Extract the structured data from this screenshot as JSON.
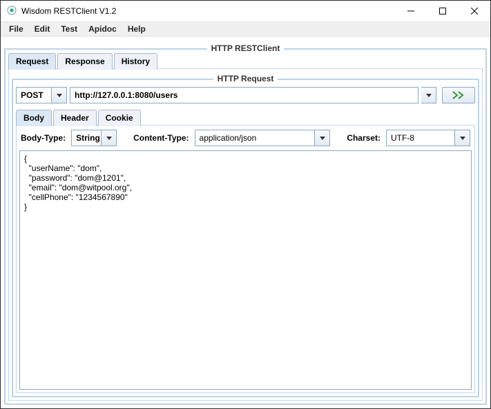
{
  "window": {
    "title": "Wisdom RESTClient V1.2"
  },
  "menu": {
    "items": [
      "File",
      "Edit",
      "Test",
      "Apidoc",
      "Help"
    ]
  },
  "group1": {
    "title": "HTTP RESTClient",
    "tabs": [
      "Request",
      "Response",
      "History"
    ],
    "active": 0
  },
  "group2": {
    "title": "HTTP Request"
  },
  "request": {
    "method": "POST",
    "url": "http://127.0.0.1:8080/users",
    "subtabs": [
      "Body",
      "Header",
      "Cookie"
    ],
    "activeSub": 0
  },
  "body": {
    "bodyTypeLabel": "Body-Type:",
    "bodyType": "String",
    "contentTypeLabel": "Content-Type:",
    "contentType": "application/json",
    "charsetLabel": "Charset:",
    "charset": "UTF-8",
    "content": "{\n  \"userName\": \"dom\",\n  \"password\": \"dom@1201\",\n  \"email\": \"dom@witpool.org\",\n  \"cellPhone\": \"1234567890\"\n}"
  }
}
